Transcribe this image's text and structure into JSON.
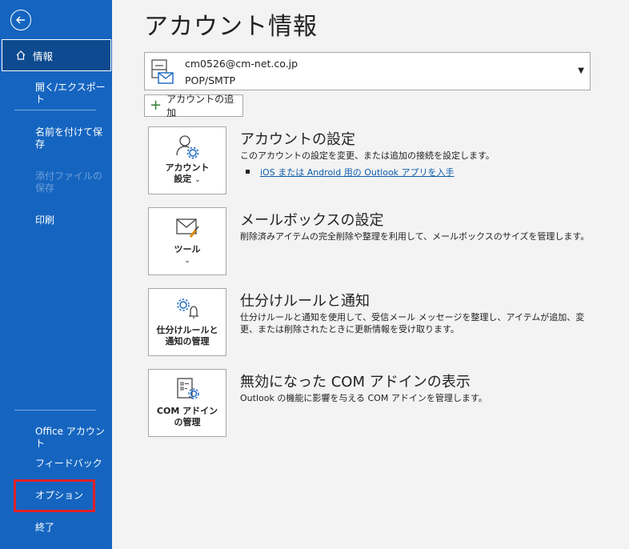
{
  "sidebar": {
    "info_label": "情報",
    "open_export_label": "開く/エクスポート",
    "save_as_label": "名前を付けて保存",
    "save_attachments_label": "添付ファイルの保存",
    "print_label": "印刷",
    "office_account_label": "Office アカウント",
    "feedback_label": "フィードバック",
    "options_label": "オプション",
    "exit_label": "終了"
  },
  "main": {
    "title": "アカウント情報",
    "account": {
      "email": "cm0526@cm-net.co.jp",
      "protocol": "POP/SMTP"
    },
    "add_account_label": "アカウントの追加",
    "sections": [
      {
        "button_label_line1": "アカウント",
        "button_label_line2": "設定",
        "title": "アカウントの設定",
        "description": "このアカウントの設定を変更、または追加の接続を設定します。",
        "link": "iOS または Android 用の Outlook アプリを入手"
      },
      {
        "button_label_line1": "ツール",
        "title": "メールボックスの設定",
        "description": "削除済みアイテムの完全削除や整理を利用して、メールボックスのサイズを管理します。"
      },
      {
        "button_label_line1": "仕分けルールと",
        "button_label_line2": "通知の管理",
        "title": "仕分けルールと通知",
        "description": "仕分けルールと通知を使用して、受信メール メッセージを整理し、アイテムが追加、変更、または削除されたときに更新情報を受け取ります。"
      },
      {
        "button_label_line1": "COM アドイン",
        "button_label_line2": "の管理",
        "title": "無効になった COM アドインの表示",
        "description": "Outlook の機能に影響を与える COM アドインを管理します。"
      }
    ]
  },
  "colors": {
    "sidebar_bg": "#1565c0",
    "selected_bg": "#0d4a8f",
    "highlight_box": "#e0202a",
    "link": "#0b5cad"
  }
}
